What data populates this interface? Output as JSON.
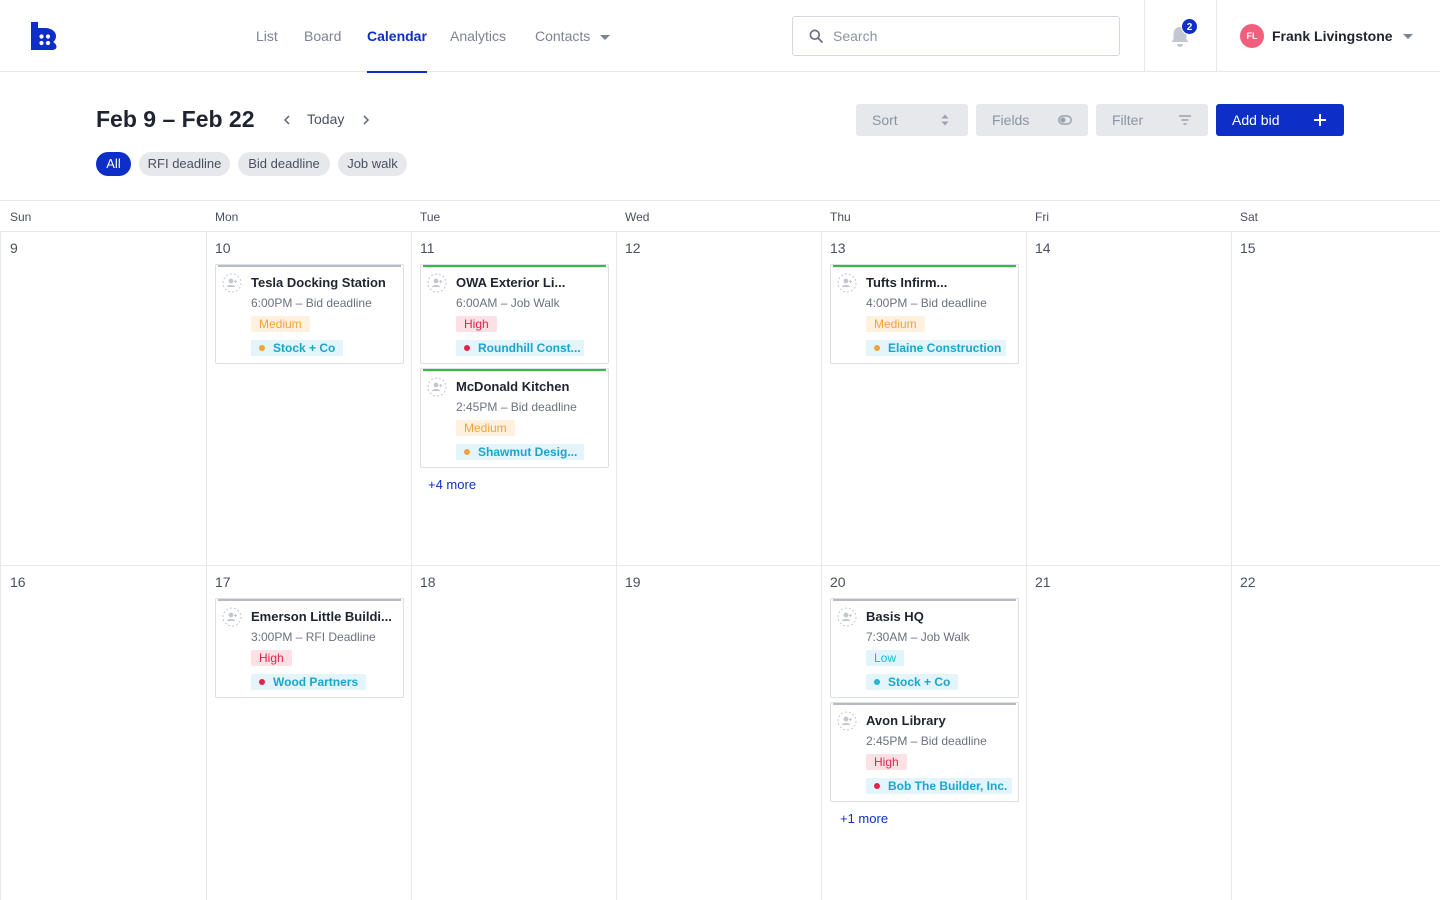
{
  "nav": {
    "items": [
      "List",
      "Board",
      "Calendar",
      "Analytics",
      "Contacts"
    ],
    "active": "Calendar"
  },
  "search": {
    "placeholder": "Search",
    "value": ""
  },
  "notifications": {
    "count": "2"
  },
  "user": {
    "initials": "FL",
    "name": "Frank Livingstone"
  },
  "toolbar": {
    "range": "Feb 9 – Feb 22",
    "today": "Today",
    "sort": "Sort",
    "fields": "Fields",
    "filter": "Filter",
    "add_bid": "Add bid"
  },
  "chips": [
    "All",
    "RFI deadline",
    "Bid deadline",
    "Job walk"
  ],
  "days_of_week": [
    "Sun",
    "Mon",
    "Tue",
    "Wed",
    "Thu",
    "Fri",
    "Sat"
  ],
  "week1": [
    "9",
    "10",
    "11",
    "12",
    "13",
    "14",
    "15"
  ],
  "week2": [
    "16",
    "17",
    "18",
    "19",
    "20",
    "21",
    "22"
  ],
  "events": [
    {
      "title": "Tesla Docking Station",
      "time": "6:00PM – Bid deadline",
      "priority": "Medium",
      "company": "Stock + Co"
    },
    {
      "title": "OWA Exterior Li...",
      "time": "6:00AM – Job Walk",
      "priority": "High",
      "company": "Roundhill Const..."
    },
    {
      "title": "McDonald Kitchen",
      "time": "2:45PM – Bid deadline",
      "priority": "Medium",
      "company": "Shawmut Desig..."
    },
    {
      "title": "Tufts Infirm...",
      "time": "4:00PM – Bid deadline",
      "priority": "Medium",
      "company": "Elaine Construction"
    },
    {
      "title": "Emerson Little Buildi...",
      "time": "3:00PM – RFI Deadline",
      "priority": "High",
      "company": "Wood Partners"
    },
    {
      "title": "Basis HQ",
      "time": "7:30AM – Job Walk",
      "priority": "Low",
      "company": "Stock + Co"
    },
    {
      "title": "Avon Library",
      "time": "2:45PM – Bid deadline",
      "priority": "High",
      "company": "Bob The Builder, Inc."
    }
  ],
  "more": {
    "tue": "+4 more",
    "thu": "+1 more"
  },
  "colors": {
    "accent": "#0d2ec7",
    "medium": "#f2a23a",
    "high": "#e3244a",
    "low": "#20b8d8"
  }
}
